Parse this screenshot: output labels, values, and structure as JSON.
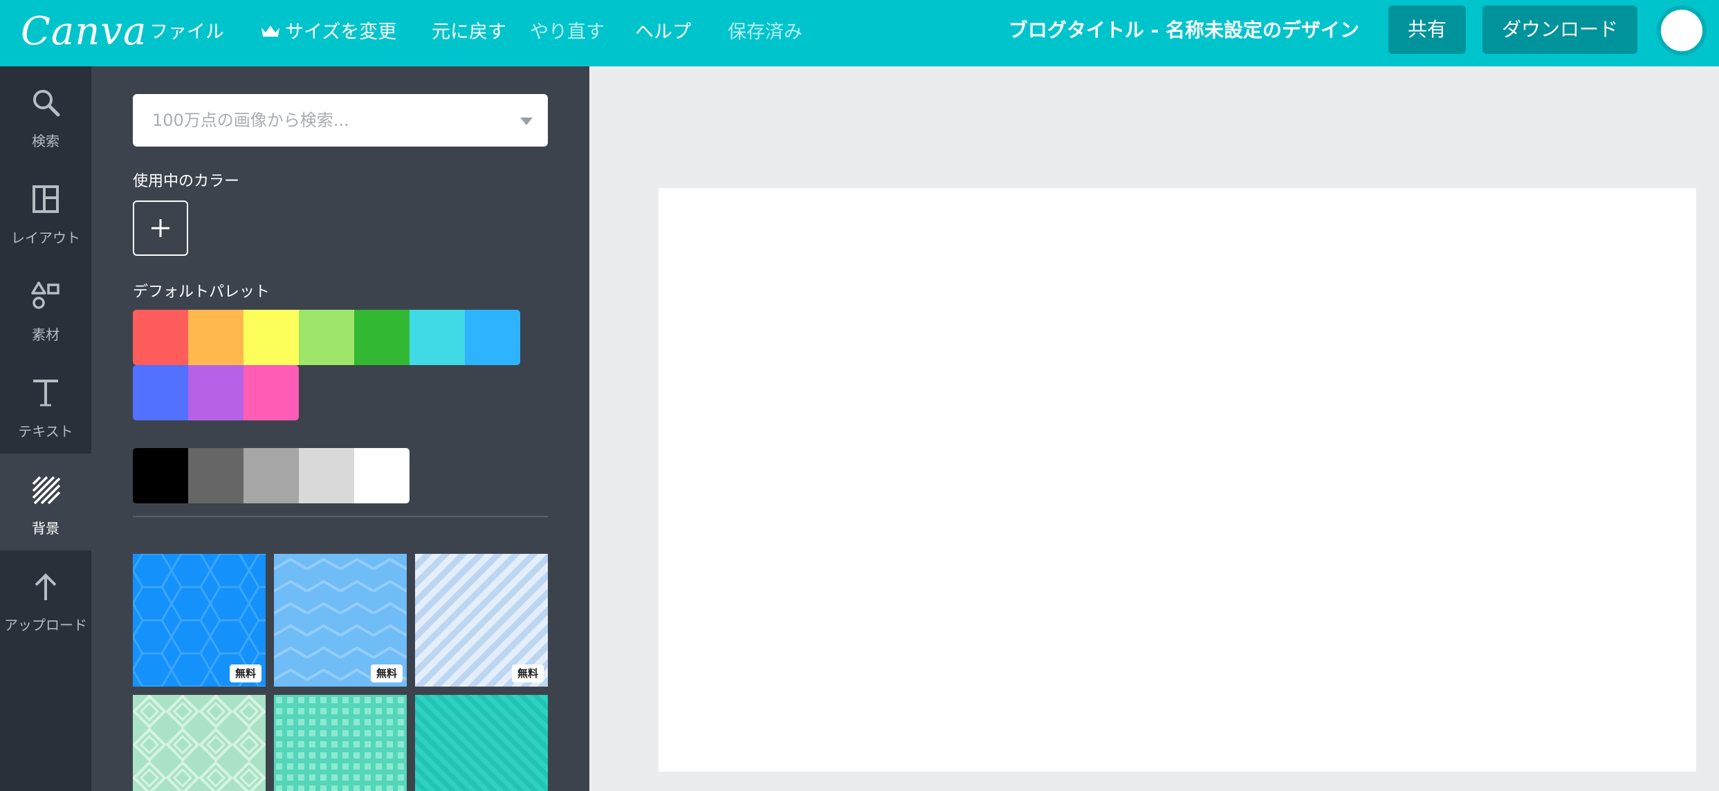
{
  "topbar": {
    "logo": "Canva",
    "menu": {
      "file": "ファイル",
      "resize": "サイズを変更",
      "undo": "元に戻す",
      "redo": "やり直す",
      "help": "ヘルプ",
      "saved": "保存済み"
    },
    "doc_title": "ブログタイトル - 名称未設定のデザイン",
    "share": "共有",
    "download": "ダウンロード",
    "colors": {
      "bar": "#00c4cc",
      "button": "#00939b"
    }
  },
  "rail": {
    "items": [
      {
        "label": "検索",
        "icon": "search-icon"
      },
      {
        "label": "レイアウト",
        "icon": "layout-icon"
      },
      {
        "label": "素材",
        "icon": "elements-icon"
      },
      {
        "label": "テキスト",
        "icon": "text-icon"
      },
      {
        "label": "背景",
        "icon": "background-icon",
        "active": true
      },
      {
        "label": "アップロード",
        "icon": "upload-icon"
      }
    ]
  },
  "panel": {
    "search_placeholder": "100万点の画像から検索...",
    "used_colors_title": "使用中のカラー",
    "default_palette_title": "デフォルトパレット",
    "palette_row1": [
      "#ff5c5c",
      "#ffb84d",
      "#ffff5c",
      "#9ee66a",
      "#33b833",
      "#40d9e6",
      "#2eb4ff"
    ],
    "palette_row2": [
      "#5271ff",
      "#b762e6",
      "#ff5cb5"
    ],
    "grays": [
      "#000000",
      "#666666",
      "#a6a6a6",
      "#d9d9d9",
      "#ffffff"
    ],
    "backgrounds": [
      {
        "name": "hexagon",
        "badge": "無料"
      },
      {
        "name": "chevron",
        "badge": "無料"
      },
      {
        "name": "diagonal-stripes",
        "badge": "無料"
      },
      {
        "name": "diamonds",
        "badge": ""
      },
      {
        "name": "dots",
        "badge": ""
      },
      {
        "name": "teal-stripes",
        "badge": ""
      }
    ]
  }
}
